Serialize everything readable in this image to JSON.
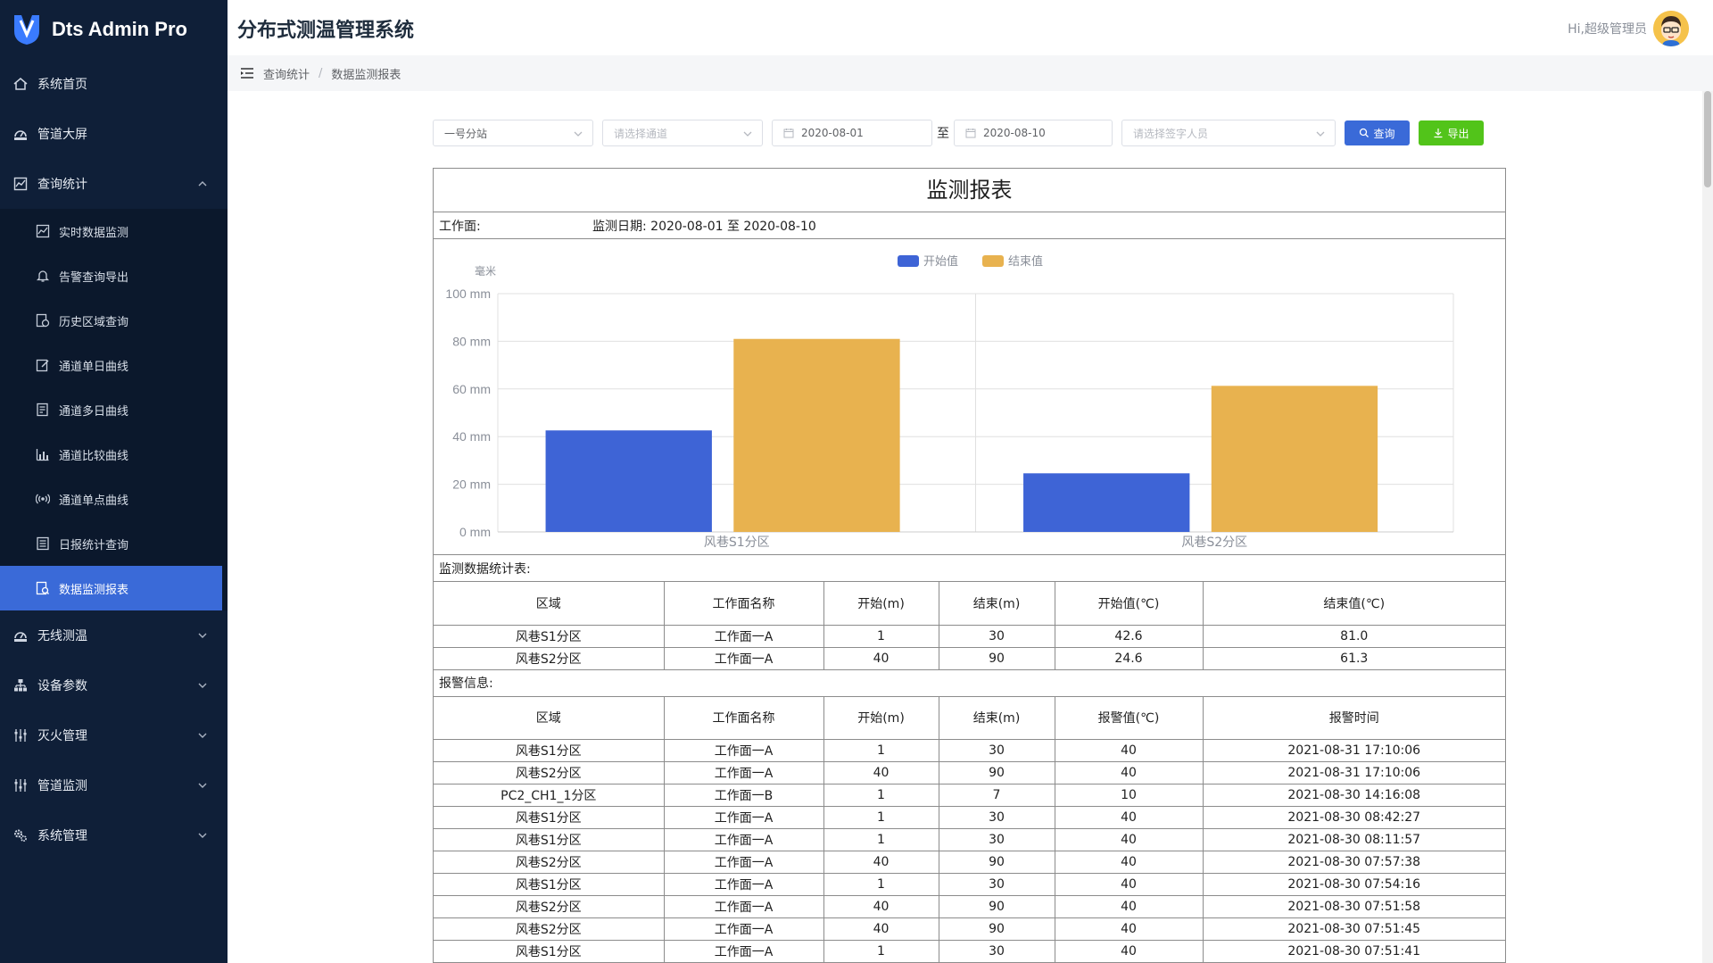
{
  "brand": {
    "name": "Dts Admin Pro"
  },
  "header": {
    "title": "分布式测温管理系统",
    "greeting": "Hi,超级管理员"
  },
  "breadcrumb": {
    "items": [
      "查询统计",
      "数据监测报表"
    ]
  },
  "sidebar": {
    "items": [
      {
        "label": "系统首页",
        "icon": "home-icon"
      },
      {
        "label": "管道大屏",
        "icon": "dashboard-icon"
      },
      {
        "label": "查询统计",
        "icon": "chart-icon",
        "expanded": true,
        "children": [
          {
            "label": "实时数据监测",
            "icon": "line-chart-icon"
          },
          {
            "label": "告警查询导出",
            "icon": "bell-icon"
          },
          {
            "label": "历史区域查询",
            "icon": "history-icon"
          },
          {
            "label": "通道单日曲线",
            "icon": "edit-icon"
          },
          {
            "label": "通道多日曲线",
            "icon": "document-icon"
          },
          {
            "label": "通道比较曲线",
            "icon": "bar-chart-icon"
          },
          {
            "label": "通道单点曲线",
            "icon": "signal-icon"
          },
          {
            "label": "日报统计查询",
            "icon": "report-icon"
          },
          {
            "label": "数据监测报表",
            "icon": "file-search-icon",
            "active": true
          }
        ]
      },
      {
        "label": "无线测温",
        "icon": "dashboard-icon"
      },
      {
        "label": "设备参数",
        "icon": "network-icon"
      },
      {
        "label": "灭火管理",
        "icon": "sliders-icon"
      },
      {
        "label": "管道监测",
        "icon": "sliders-icon"
      },
      {
        "label": "系统管理",
        "icon": "gears-icon"
      }
    ]
  },
  "filters": {
    "station": "一号分站",
    "channel_placeholder": "请选择通道",
    "start_date": "2020-08-01",
    "to": "至",
    "end_date": "2020-08-10",
    "signer_placeholder": "请选择签字人员",
    "query_label": "查询",
    "export_label": "导出"
  },
  "report": {
    "title": "监测报表",
    "workface_label": "工作面:",
    "date_label": "监测日期: 2020-08-01 至 2020-08-10",
    "stats_label": "监测数据统计表:",
    "alarm_label": "报警信息:",
    "stats_headers": [
      "区域",
      "工作面名称",
      "开始(m)",
      "结束(m)",
      "开始值(℃)",
      "结束值(℃)"
    ],
    "stats_rows": [
      [
        "风巷S1分区",
        "工作面一A",
        "1",
        "30",
        "42.6",
        "81.0"
      ],
      [
        "风巷S2分区",
        "工作面一A",
        "40",
        "90",
        "24.6",
        "61.3"
      ]
    ],
    "alarm_headers": [
      "区域",
      "工作面名称",
      "开始(m)",
      "结束(m)",
      "报警值(℃)",
      "报警时间"
    ],
    "alarm_rows": [
      [
        "风巷S1分区",
        "工作面一A",
        "1",
        "30",
        "40",
        "2021-08-31 17:10:06"
      ],
      [
        "风巷S2分区",
        "工作面一A",
        "40",
        "90",
        "40",
        "2021-08-31 17:10:06"
      ],
      [
        "PC2_CH1_1分区",
        "工作面一B",
        "1",
        "7",
        "10",
        "2021-08-30 14:16:08"
      ],
      [
        "风巷S1分区",
        "工作面一A",
        "1",
        "30",
        "40",
        "2021-08-30 08:42:27"
      ],
      [
        "风巷S1分区",
        "工作面一A",
        "1",
        "30",
        "40",
        "2021-08-30 08:11:57"
      ],
      [
        "风巷S2分区",
        "工作面一A",
        "40",
        "90",
        "40",
        "2021-08-30 07:57:38"
      ],
      [
        "风巷S1分区",
        "工作面一A",
        "1",
        "30",
        "40",
        "2021-08-30 07:54:16"
      ],
      [
        "风巷S2分区",
        "工作面一A",
        "40",
        "90",
        "40",
        "2021-08-30 07:51:58"
      ],
      [
        "风巷S2分区",
        "工作面一A",
        "40",
        "90",
        "40",
        "2021-08-30 07:51:45"
      ],
      [
        "风巷S1分区",
        "工作面一A",
        "1",
        "30",
        "40",
        "2021-08-30 07:51:41"
      ]
    ]
  },
  "colors": {
    "sidebar_bg": "#0f1f38",
    "accent": "#3a6ad8",
    "success": "#52c41a",
    "series_start": "#3e64d6",
    "series_end": "#e8b24f"
  },
  "chart_data": {
    "type": "bar",
    "categories": [
      "风巷S1分区",
      "风巷S2分区"
    ],
    "series": [
      {
        "name": "开始值",
        "values": [
          42.6,
          24.6
        ],
        "color": "#3e64d6"
      },
      {
        "name": "结束值",
        "values": [
          81.0,
          61.3
        ],
        "color": "#e8b24f"
      }
    ],
    "ylabel": "毫米",
    "ylim": [
      0,
      100
    ],
    "yticks": [
      "0 mm",
      "20 mm",
      "40 mm",
      "60 mm",
      "80 mm",
      "100 mm"
    ],
    "grid": true,
    "legend": "top-center"
  }
}
